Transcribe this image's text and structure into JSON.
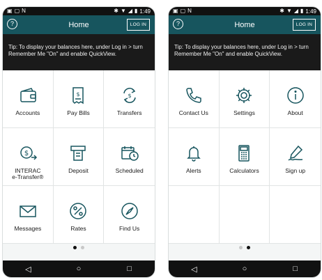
{
  "colors": {
    "appbar": "#17555e",
    "icon": "#17555e",
    "tip_bg": "#1a1a1a"
  },
  "screens": [
    {
      "status": {
        "time": "1:49",
        "left_icons": [
          "gallery-icon",
          "notification-icon",
          "n-icon"
        ],
        "right_icons": [
          "bluetooth-icon",
          "wifi-icon",
          "signal-icon",
          "battery-icon"
        ]
      },
      "appbar": {
        "title": "Home",
        "help": "?",
        "login": "LOG IN"
      },
      "tip": "Tip: To display your balances here, under Log in > turn Remember Me \"On\" and enable QuickView.",
      "tiles": [
        {
          "label": "Accounts",
          "icon": "wallet-icon"
        },
        {
          "label": "Pay Bills",
          "icon": "bill-icon"
        },
        {
          "label": "Transfers",
          "icon": "transfer-icon"
        },
        {
          "label": "INTERAC",
          "label2": "e-Transfer®",
          "icon": "etransfer-icon"
        },
        {
          "label": "Deposit",
          "icon": "atm-icon"
        },
        {
          "label": "Scheduled",
          "icon": "calendar-clock-icon"
        },
        {
          "label": "Messages",
          "icon": "envelope-icon"
        },
        {
          "label": "Rates",
          "icon": "percent-icon"
        },
        {
          "label": "Find Us",
          "icon": "compass-icon"
        }
      ],
      "page_indicator": {
        "active": 0,
        "count": 2
      }
    },
    {
      "status": {
        "time": "1:49",
        "left_icons": [
          "gallery-icon",
          "notification-icon",
          "n-icon"
        ],
        "right_icons": [
          "bluetooth-icon",
          "wifi-icon",
          "signal-icon",
          "battery-icon"
        ]
      },
      "appbar": {
        "title": "Home",
        "help": "?",
        "login": "LOG IN"
      },
      "tip": "Tip: To display your balances here, under Log in > turn Remember Me \"On\" and enable QuickView.",
      "tiles": [
        {
          "label": "Contact Us",
          "icon": "phone-icon"
        },
        {
          "label": "Settings",
          "icon": "gear-icon"
        },
        {
          "label": "About",
          "icon": "info-icon"
        },
        {
          "label": "Alerts",
          "icon": "bell-icon"
        },
        {
          "label": "Calculators",
          "icon": "calculator-icon"
        },
        {
          "label": "Sign up",
          "icon": "signature-icon"
        }
      ],
      "page_indicator": {
        "active": 1,
        "count": 2
      }
    }
  ],
  "navbar": {
    "back": "◁",
    "home": "○",
    "recents": "□"
  }
}
